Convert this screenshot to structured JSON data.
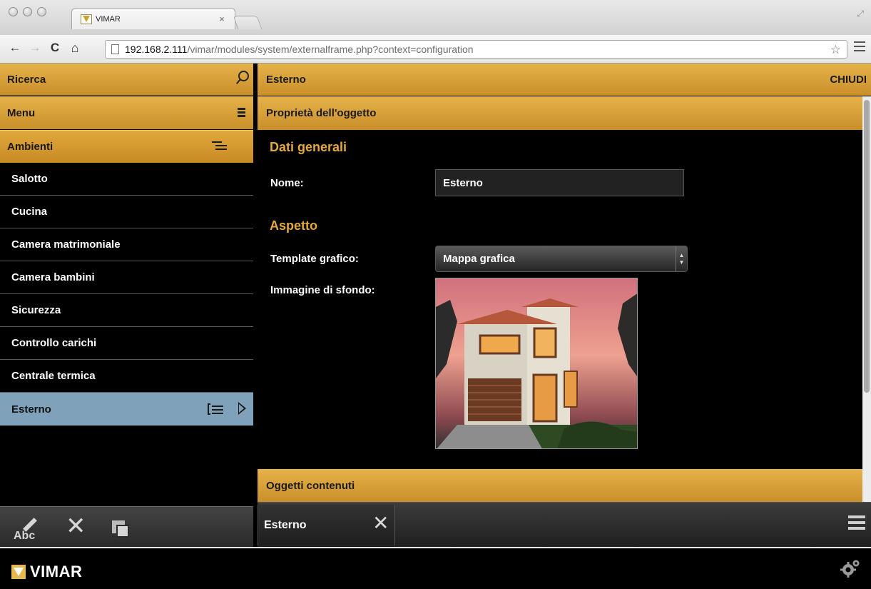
{
  "browser": {
    "tab_title": "VIMAR",
    "tab_close": "×",
    "url_host": "192.168.2.111",
    "url_path": "/vimar/modules/system/externalframe.php?context=configuration"
  },
  "sidebar": {
    "search_label": "Ricerca",
    "menu_label": "Menu",
    "rooms_header": "Ambienti",
    "rooms": [
      {
        "label": "Salotto"
      },
      {
        "label": "Cucina"
      },
      {
        "label": "Camera matrimoniale"
      },
      {
        "label": "Camera bambini"
      },
      {
        "label": "Sicurezza"
      },
      {
        "label": "Controllo carichi"
      },
      {
        "label": "Centrale termica"
      },
      {
        "label": "Esterno",
        "selected": true
      }
    ],
    "toolbar": {
      "rename_label": "Abc",
      "delete_glyph": "✕"
    }
  },
  "main": {
    "title": "Esterno",
    "close_label": "CHIUDI",
    "properties_header": "Proprietà dell'oggetto",
    "general_section": "Dati generali",
    "name_label": "Nome:",
    "name_value": "Esterno",
    "appearance_section": "Aspetto",
    "template_label": "Template grafico:",
    "template_value": "Mappa grafica",
    "background_label": "Immagine di sfondo:",
    "contents_header": "Oggetti contenuti"
  },
  "tabbar": {
    "open_tab_label": "Esterno",
    "open_tab_close": "✕"
  },
  "footer": {
    "brand": "VIMAR"
  },
  "colors": {
    "accent_gold": "#e0a83c",
    "section_title": "#e5a83b",
    "selected_room": "#7fa2ba"
  }
}
